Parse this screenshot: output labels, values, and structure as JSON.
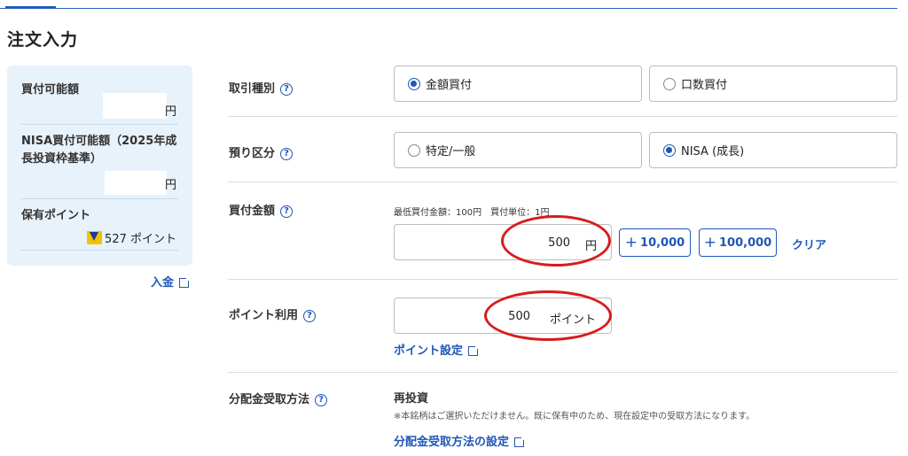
{
  "page": {
    "title": "注文入力"
  },
  "summary": {
    "buying_power_label": "買付可能額",
    "buying_power_unit": "円",
    "nisa_label": "NISA買付可能額（2025年成長投資枠基準）",
    "nisa_unit": "円",
    "points_label": "保有ポイント",
    "points_value": "527 ポイント",
    "deposit_link": "入金"
  },
  "form": {
    "trade_type": {
      "label": "取引種別",
      "options": [
        {
          "label": "金額買付",
          "selected": true
        },
        {
          "label": "口数買付",
          "selected": false
        }
      ]
    },
    "custody": {
      "label": "預り区分",
      "options": [
        {
          "label": "特定/一般",
          "selected": false
        },
        {
          "label": "NISA (成長)",
          "selected": true
        }
      ]
    },
    "amount": {
      "label": "買付金額",
      "note": "最低買付金額：100円　買付単位：1円",
      "value": "500",
      "unit": "円",
      "add_10000": "10,000",
      "add_100000": "100,000",
      "clear": "クリア"
    },
    "points": {
      "label": "ポイント利用",
      "value": "500",
      "unit": "ポイント",
      "settings_link": "ポイント設定"
    },
    "dividend": {
      "label": "分配金受取方法",
      "value": "再投資",
      "note": "※本銘柄はご選択いただけません。既に保有中のため、現在設定中の受取方法になります。",
      "settings_link": "分配金受取方法の設定"
    }
  },
  "colors": {
    "accent": "#1f57b8",
    "annotation": "#d81b1b",
    "summary_bg": "#e8f2fb"
  }
}
